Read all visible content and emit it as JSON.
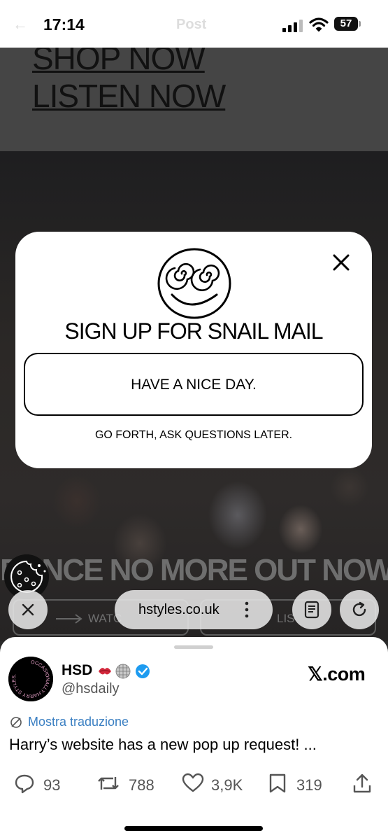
{
  "status_bar": {
    "time": "17:14",
    "battery": "57",
    "ghost_back": "←",
    "ghost_title": "Post"
  },
  "site": {
    "shop_now": "SHOP NOW",
    "listen_now": "LISTEN NOW",
    "dance_banner": "DANCE NO MORE OUT NOW",
    "watch_label": "WATC",
    "listen_label": "LIS"
  },
  "popup": {
    "title": "SIGN UP FOR SNAIL MAIL",
    "primary_button": "HAVE A NICE DAY.",
    "secondary_link": "GO FORTH, ASK QUESTIONS LATER."
  },
  "browser": {
    "url": "hstyles.co.uk"
  },
  "tweet": {
    "name": "HSD",
    "handle": "@hsdaily",
    "source": "𝕏.com",
    "translate": "Mostra traduzione",
    "text": "Harry’s website has a new pop up request! ...",
    "stats": {
      "replies": "93",
      "retweets": "788",
      "likes": "3,9K",
      "bookmarks": "319"
    },
    "avatar_text": "OCCASIONALLY.HARRY STYLES."
  },
  "colors": {
    "link_blue": "#3a7fc2",
    "verified_blue": "#1d9bf0",
    "popup_bg": "#ffffff",
    "overlay_dark": "#454545"
  }
}
